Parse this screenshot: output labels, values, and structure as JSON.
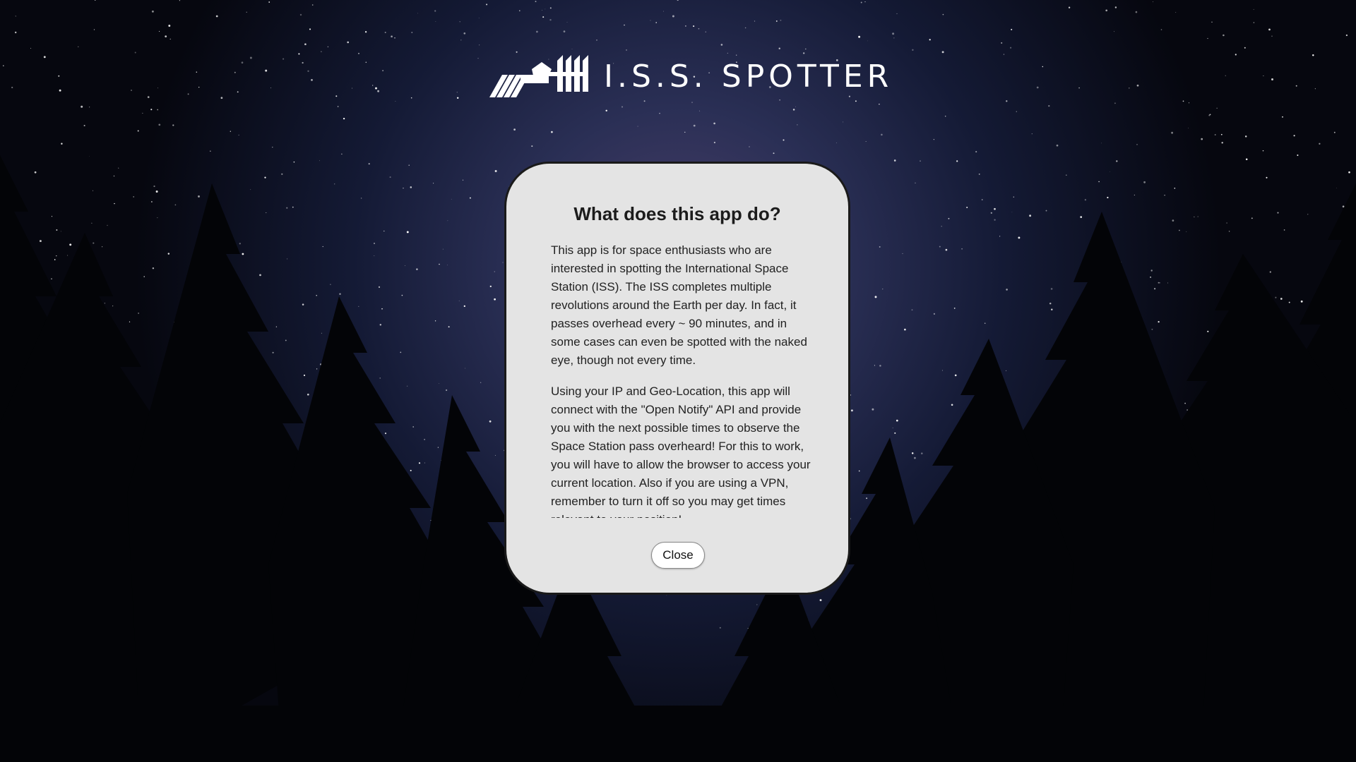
{
  "header": {
    "title": "I.S.S. SPOTTER",
    "logo_icon": "space-station-icon"
  },
  "modal": {
    "title": "What does this app do?",
    "paragraphs": [
      "This app is for space enthusiasts who are interested in spotting the International Space Station (ISS). The ISS completes multiple revolutions around the Earth per day. In fact, it passes overhead every ~ 90 minutes, and in some cases can even be spotted with the naked eye, though not every time.",
      "Using your IP and Geo-Location, this app will connect with the \"Open Notify\" API and provide you with the next possible times to observe the Space Station pass overheard! For this to work, you will have to allow the browser to access your current location. Also if you are using a VPN, remember to turn it off so you may get times relevant to your position!"
    ],
    "close_label": "Close"
  },
  "colors": {
    "modal_background": "#e4e4e4",
    "title_text": "#ffffff",
    "sky_center": "#4a3f6a",
    "sky_edge": "#06070f"
  }
}
